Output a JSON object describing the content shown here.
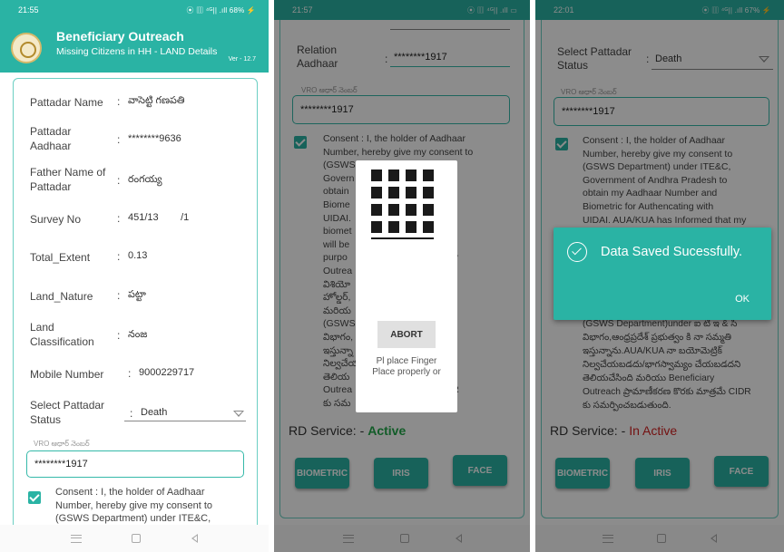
{
  "screen1": {
    "status": {
      "time": "21:55",
      "icons": "⦿ ▥ ⁴ᴳ|| .ıll 68% ⚡"
    },
    "app": {
      "title": "Beneficiary Outreach",
      "subtitle": "Missing Citizens in HH - LAND  Details",
      "version": "Ver - 12.7"
    },
    "fields": [
      {
        "label": "Pattadar Name",
        "value": "వాసెట్టి గణపతి"
      },
      {
        "label": "Pattadar Aadhaar",
        "value": "********9636"
      },
      {
        "label": "Father Name of Pattadar",
        "value": "రంగయ్య"
      },
      {
        "label": "Survey No",
        "value": "451/13        /1"
      },
      {
        "label": "Total_Extent",
        "value": "0.13"
      },
      {
        "label": "Land_Nature",
        "value": "పట్టా"
      },
      {
        "label": "Land Classification",
        "value": "నంజ"
      },
      {
        "label": "Mobile Number",
        "value": "9000229717"
      }
    ],
    "status_field": {
      "label": "Select Pattadar Status",
      "value": "Death"
    },
    "vro": {
      "label": "VRO ఆధార్ నెంబర్",
      "value": "********1917"
    },
    "consent": "Consent : I, the holder of Aadhaar Number, hereby give my consent to (GSWS Department) under ITE&C,"
  },
  "screen2": {
    "status": {
      "time": "21:57",
      "icons": "⦿ ▥ ⁴ᴳ|| .ıll ▭"
    },
    "relation": {
      "label": "Relation Aadhaar",
      "value": "********1917"
    },
    "vro": {
      "label": "VRO ఆధార్ నెంబర్",
      "value": "********1917"
    },
    "consent_lines": [
      "Consent : I, the holder of Aadhaar",
      "Number, hereby give my consent to",
      "(GSWS                     ITE&C,",
      "Govern                     esh to",
      "obtain                      and",
      "Biome                      with",
      "UIDAI.                    ed that my",
      "biomet                    /shared and",
      "will be                    nly for the",
      "purpo                     n Beneficiary",
      "Outrea",
      "విశియో                   ార్ నంబర్",
      "హోల్డర్,                   బర్",
      "మరియ                    ందటానికి",
      "(GSWS                   టీ ఇ & సి",
      "విభాగం,                  నా సమ్మతి",
      "ఇస్తున్నా                  మెట్రిక్",
      "నిల్వచేయ                  చేయబడదని",
      "తెలియ                    iary",
      "Outrea                   మాత్రమే CIDR",
      "కు సమ"
    ],
    "dialog": {
      "abort": "ABORT",
      "msg1": "Pl place Finger",
      "msg2": "Place properly or"
    },
    "rd": {
      "label": "RD Service: -",
      "state": "Active"
    },
    "buttons": {
      "biometric": "BIOMETRIC",
      "iris": "IRIS",
      "face": "FACE"
    }
  },
  "screen3": {
    "status": {
      "time": "22:01",
      "icons": "⦿ ▥ ⁴ᴳ|| .ıll 67% ⚡"
    },
    "status_field": {
      "label": "Select Pattadar Status",
      "value": "Death"
    },
    "vro": {
      "label": "VRO ఆధార్ నెంబర్",
      "value": "********1917"
    },
    "consent_top": [
      "Consent : I, the holder of Aadhaar",
      "Number, hereby give my consent to",
      "(GSWS Department) under ITE&C,",
      "Government of Andhra Pradesh to",
      "obtain my Aadhaar Number and",
      "Biometric for Authencating with",
      "UIDAI. AUA/KUA has Informed that my"
    ],
    "consent_bottom": [
      "(GSWS Department)under ఐ టీ ఇ & సి",
      "విభాగం,ఆంధ్రప్రదేశ్ ప్రభుత్వం కి నా సమ్మతి",
      "ఇస్తున్నాను.AUA/KUA నా బయోమెట్రిక్",
      "నిల్వచేయబడదు/భాగస్వామ్యం చేయబడదని",
      "తెలియచేసింది మరియు Beneficiary",
      "Outreach ప్రామాణీకరణ కొరకు మాత్రమే CIDR",
      "కు సమర్పించబడుతుంది."
    ],
    "toast": {
      "message": "Data Saved Sucessfully.",
      "ok": "OK"
    },
    "rd": {
      "label": "RD Service: -",
      "state": "In Active"
    },
    "buttons": {
      "biometric": "BIOMETRIC",
      "iris": "IRIS",
      "face": "FACE"
    }
  },
  "colors": {
    "teal": "#2ab3a4",
    "active": "#21a84a",
    "inactive": "#d32222"
  }
}
